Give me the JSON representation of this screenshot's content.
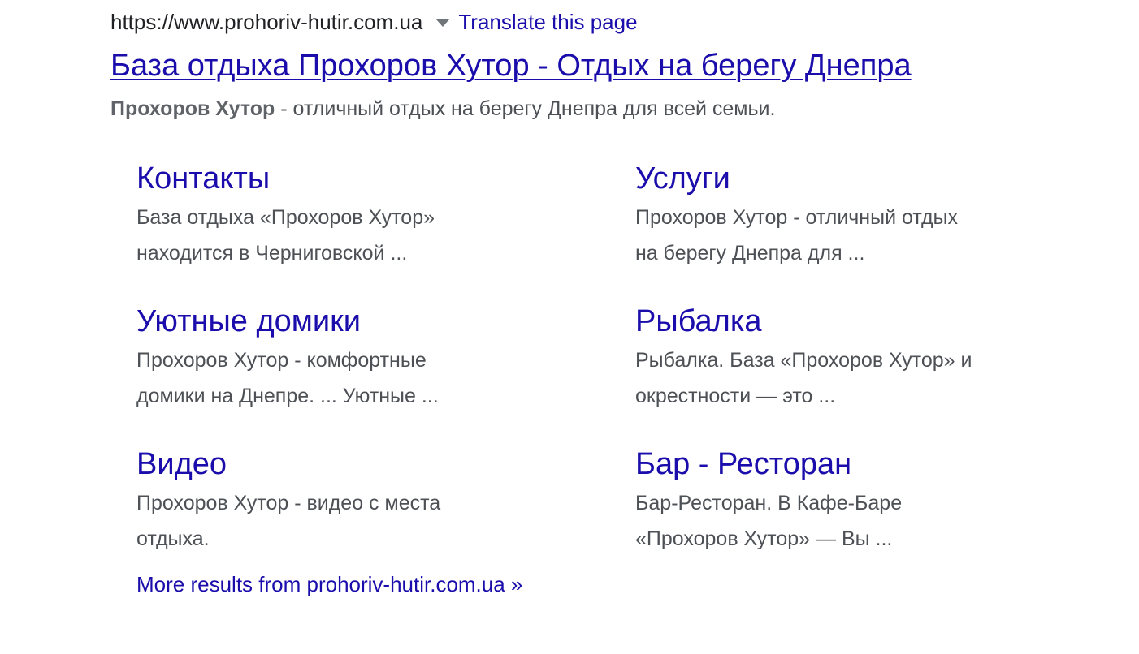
{
  "result": {
    "url": "https://www.prohoriv-hutir.com.ua",
    "translate_label": "Translate this page",
    "title": "База отдыха Прохоров Хутор - Отдых на берегу Днепра",
    "snippet_bold": "Прохоров Хутор",
    "snippet_rest": " - отличный отдых на берегу Днепра для всей семьи."
  },
  "sitelinks": [
    {
      "title": "Контакты",
      "desc": "База отдыха «Прохоров Хутор» находится в Черниговской ..."
    },
    {
      "title": "Услуги",
      "desc": "Прохоров Хутор - отличный отдых на берегу Днепра для ..."
    },
    {
      "title": "Уютные домики",
      "desc": "Прохоров Хутор - комфортные домики на Днепре. ... Уютные ..."
    },
    {
      "title": "Рыбалка",
      "desc": "Рыбалка. База «Прохоров Хутор» и окрестности — это ..."
    },
    {
      "title": "Видео",
      "desc": "Прохоров Хутор - видео с места отдыха."
    },
    {
      "title": "Бар - Ресторан",
      "desc": "Бар-Ресторан. В Кафе-Баре «Прохоров Хутор» — Вы ..."
    }
  ],
  "more_results": "More results from prohoriv-hutir.com.ua »",
  "colors": {
    "link": "#1a0dab",
    "text": "#4d5156",
    "url": "#202124"
  },
  "icons": {
    "dropdown": "caret-down-icon"
  }
}
